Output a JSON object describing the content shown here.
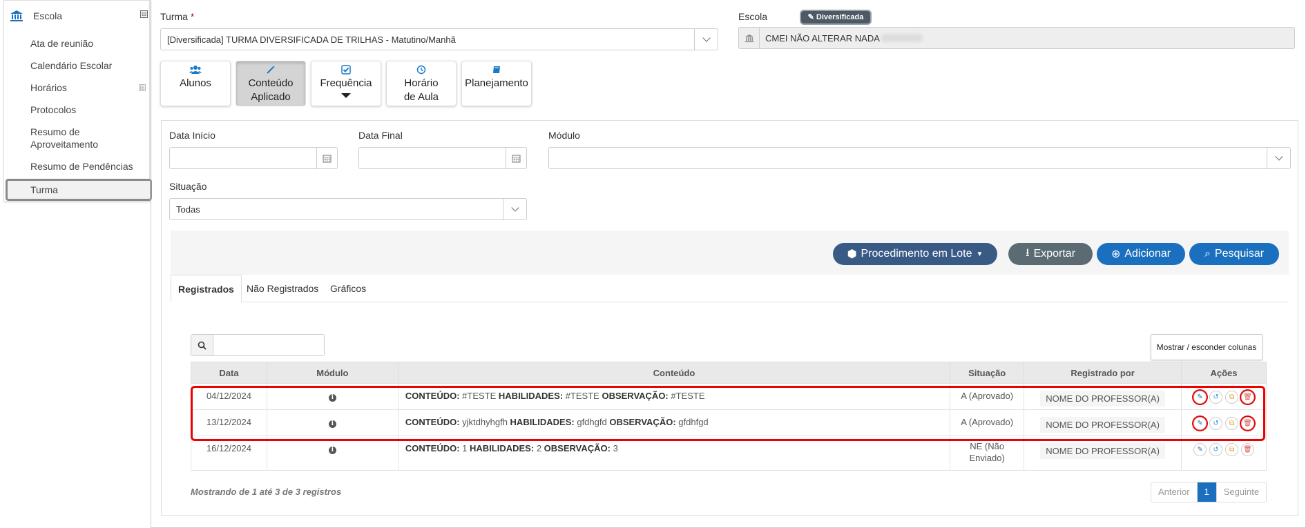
{
  "sidebar": {
    "title": "Escola",
    "collapse_symbol": "⊟",
    "expand_symbol": "⊞",
    "items": [
      {
        "label": "Ata de reunião"
      },
      {
        "label": "Calendário Escolar"
      },
      {
        "label": "Horários"
      },
      {
        "label": "Protocolos"
      },
      {
        "label": "Resumo de Aproveitamento"
      },
      {
        "label": "Resumo de Pendências"
      },
      {
        "label": "Turma"
      }
    ]
  },
  "form": {
    "turma_label": "Turma",
    "required_mark": "*",
    "turma_value": "[Diversificada]  TURMA DIVERSIFICADA DE TRILHAS - Matutino/Manhã",
    "badge": "Diversificada",
    "escola_label": "Escola",
    "escola_value": "CMEI NÃO ALTERAR NADA"
  },
  "tiles": [
    {
      "label": "Alunos",
      "icon": "users-icon"
    },
    {
      "label": "Conteúdo Aplicado",
      "icon": "wand-icon"
    },
    {
      "label": "Frequência",
      "icon": "check-icon"
    },
    {
      "label": "Horário de Aula",
      "icon": "clock-icon"
    },
    {
      "label": "Planejamento",
      "icon": "book-icon"
    }
  ],
  "filters": {
    "data_inicio": "Data Início",
    "data_final": "Data Final",
    "modulo": "Módulo",
    "situacao": "Situação",
    "situacao_value": "Todas"
  },
  "actions": {
    "lote": "Procedimento em Lote",
    "exportar": "Exportar",
    "adicionar": "Adicionar",
    "pesquisar": "Pesquisar"
  },
  "tabs": [
    "Registrados",
    "Não Registrados",
    "Gráficos"
  ],
  "table": {
    "toggle_columns": "Mostrar / esconder colunas",
    "headers": [
      "Data",
      "Módulo",
      "Conteúdo",
      "Situação",
      "Registrado por",
      "Ações"
    ],
    "rows": [
      {
        "date": "04/12/2024",
        "k1": "CONTEÚDO:",
        "v1": "#TESTE",
        "k2": "HABILIDADES:",
        "v2": "#TESTE",
        "k3": "OBSERVAÇÃO:",
        "v3": "#TESTE",
        "status": "A (Aprovado)",
        "by": "NOME DO PROFESSOR(A)"
      },
      {
        "date": "13/12/2024",
        "k1": "CONTEÚDO:",
        "v1": "yjktdhyhgfh",
        "k2": "HABILIDADES:",
        "v2": "gfdhgfd",
        "k3": "OBSERVAÇÃO:",
        "v3": "gfdhfgd",
        "status": "A (Aprovado)",
        "by": "NOME DO PROFESSOR(A)"
      },
      {
        "date": "16/12/2024",
        "k1": "CONTEÚDO:",
        "v1": "1",
        "k2": "HABILIDADES:",
        "v2": "2",
        "k3": "OBSERVAÇÃO:",
        "v3": "3",
        "status": "NE (Não Enviado)",
        "by": "NOME DO PROFESSOR(A)"
      }
    ],
    "footer": "Mostrando de 1 até 3 de 3 registros",
    "pager": {
      "prev": "Anterior",
      "current": "1",
      "next": "Seguinte"
    }
  },
  "colors": {
    "primary": "#1a6fbf",
    "lote": "#3a5a86",
    "exportar": "#5a6b73",
    "highlight": "#e00000"
  }
}
